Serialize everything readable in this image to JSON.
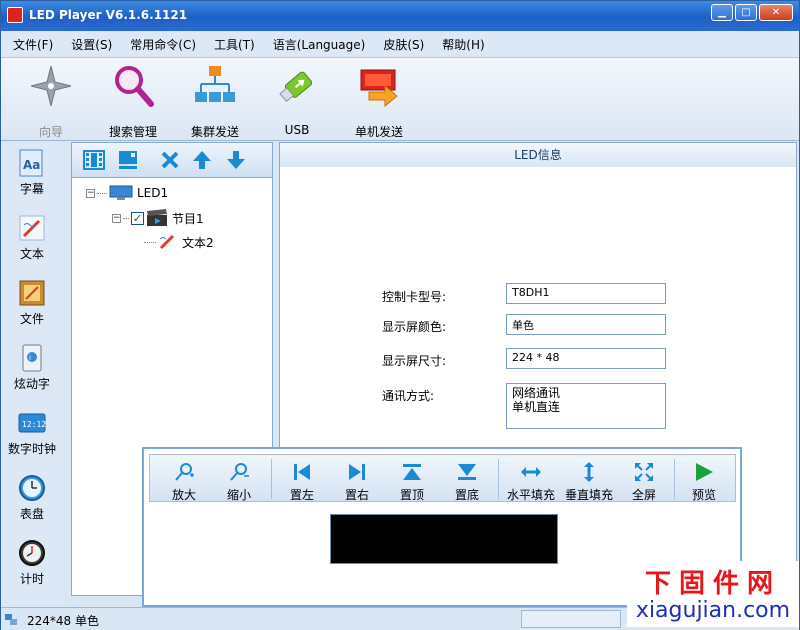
{
  "window": {
    "title": "LED Player V6.1.6.1121",
    "min": "▁",
    "max": "□",
    "close": "✕"
  },
  "menu": [
    "文件(F)",
    "设置(S)",
    "常用命令(C)",
    "工具(T)",
    "语言(Language)",
    "皮肤(S)",
    "帮助(H)"
  ],
  "toolbar": {
    "wizard": "向导",
    "search": "搜索管理",
    "cluster": "集群发送",
    "usb": "USB",
    "single_send": "单机发送"
  },
  "leftbar": [
    "字幕",
    "文本",
    "文件",
    "炫动字",
    "数字时钟",
    "表盘",
    "计时"
  ],
  "tree": {
    "root": "LED1",
    "program": "节目1",
    "program_checked": "✓",
    "item": "文本2",
    "expand": "−"
  },
  "info": {
    "header": "LED信息",
    "card_label": "控制卡型号:",
    "card_value": "T8DH1",
    "color_label": "显示屏颜色:",
    "color_value": "单色",
    "size_label": "显示屏尺寸:",
    "size_value": "224 * 48",
    "comm_label": "通讯方式:",
    "comm_value_1": "网络通讯",
    "comm_value_2": "单机直连"
  },
  "preview": {
    "zoom_in": "放大",
    "zoom_out": "缩小",
    "left": "置左",
    "right": "置右",
    "top": "置顶",
    "bottom": "置底",
    "hfill": "水平填充",
    "vfill": "垂直填充",
    "full": "全屏",
    "play": "预览"
  },
  "status": {
    "text": "224*48 单色"
  },
  "watermark": {
    "line1": "下固件网",
    "line2": "xiagujian.com"
  },
  "colors": {
    "title_bar": "#1d5fc4",
    "panel_bg": "#d9e6f4",
    "accent_blue": "#1a8ad4",
    "play_green": "#19a23b",
    "watermark_red": "#e8151b",
    "watermark_blue": "#1d2fb5"
  }
}
